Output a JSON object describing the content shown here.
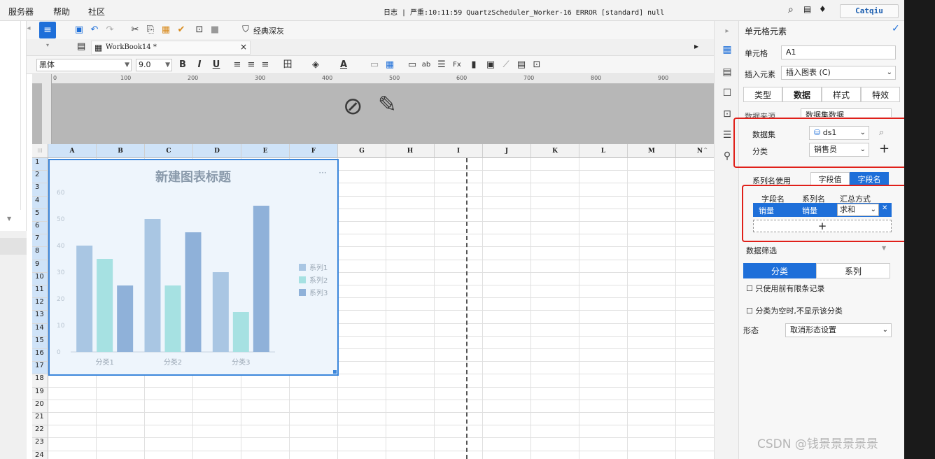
{
  "menu": {
    "items": [
      "服务器",
      "帮助",
      "社区"
    ]
  },
  "log_text": "日志 | 严重:10:11:59 QuartzScheduler_Worker-16 ERROR [standard] null",
  "user": "Catqiu",
  "toolbar": {
    "template_style_label": "经典深灰",
    "tab_name": "WorkBook14 *",
    "font_name": "黑体",
    "font_size": "9.0"
  },
  "ruler_ticks": [
    "0",
    "100",
    "200",
    "300",
    "400",
    "500",
    "600",
    "700",
    "800",
    "900"
  ],
  "columns": [
    "A",
    "B",
    "C",
    "D",
    "E",
    "F",
    "G",
    "H",
    "I",
    "J",
    "K",
    "L",
    "M",
    "N"
  ],
  "rows": [
    "1",
    "2",
    "3",
    "4",
    "5",
    "6",
    "7",
    "8",
    "9",
    "10",
    "11",
    "12",
    "13",
    "14",
    "15",
    "16",
    "17",
    "18",
    "19",
    "20",
    "21",
    "22",
    "23",
    "24"
  ],
  "chart_data": {
    "type": "bar",
    "title": "新建图表标题",
    "categories": [
      "分类1",
      "分类2",
      "分类3"
    ],
    "series": [
      {
        "name": "系列1",
        "values": [
          40,
          50,
          30
        ],
        "color": "#a9c6e3"
      },
      {
        "name": "系列2",
        "values": [
          35,
          25,
          15
        ],
        "color": "#a6e1e2"
      },
      {
        "name": "系列3",
        "values": [
          25,
          45,
          55
        ],
        "color": "#8fb1d9"
      }
    ],
    "ylim": [
      0,
      60
    ],
    "yticks": [
      "0",
      "10",
      "20",
      "30",
      "40",
      "50",
      "60"
    ],
    "legend_position": "right",
    "more_icon": "···"
  },
  "panel": {
    "title": "单元格元素",
    "cell_label": "单元格",
    "cell_value": "A1",
    "insert_label": "插入元素",
    "insert_value": "插入图表 (C)",
    "tabs": [
      "类型",
      "数据",
      "样式",
      "特效"
    ],
    "data_source_label": "数据来源",
    "data_source_value": "数据集数据",
    "dataset_label": "数据集",
    "dataset_value": "ds1",
    "category_label": "分类",
    "category_value": "销售员",
    "series_name_use_label": "系列名使用",
    "series_name_options": [
      "字段值",
      "字段名"
    ],
    "field_headers": [
      "字段名",
      "系列名",
      "汇总方式"
    ],
    "field_row": {
      "field": "销量",
      "series": "销量",
      "agg": "求和"
    },
    "add_symbol": "+",
    "filter_label": "数据筛选",
    "filter_tabs": [
      "分类",
      "系列"
    ],
    "check1": "只使用前有限条记录",
    "check2": "分类为空时,不显示该分类",
    "shape_label": "形态",
    "shape_value": "取消形态设置"
  },
  "colors": {
    "accent": "#1e6fd9",
    "highlight_box": "#e0201a",
    "selection": "#3b86db"
  },
  "watermark": "CSDN @钱景景景景景"
}
